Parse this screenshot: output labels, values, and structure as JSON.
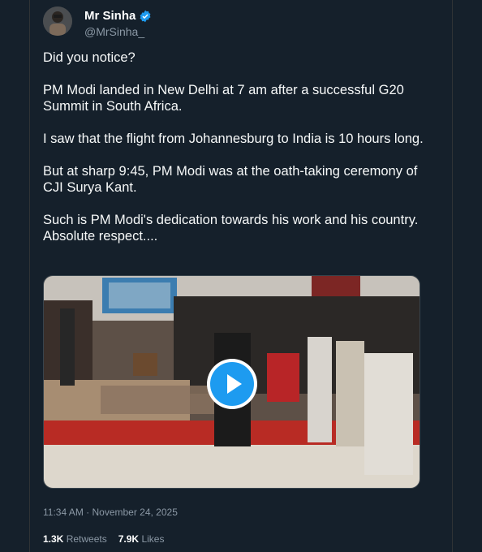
{
  "author": {
    "display_name": "Mr Sinha",
    "handle": "@MrSinha_",
    "verified_icon": "verified-badge-icon",
    "accent_color": "#1d9bf0"
  },
  "tweet": {
    "paragraphs": [
      "Did you notice?",
      "PM Modi landed in New Delhi at 7 am after a successful G20 Summit in South Africa.",
      "I saw that the flight from Johannesburg to India is 10 hours long.",
      "But at sharp 9:45, PM Modi was at the oath-taking ceremony of CJI Surya Kant.",
      "Such is PM Modi's dedication towards his work and his country. Absolute respect...."
    ],
    "media_icon": "play-icon"
  },
  "meta": {
    "timestamp": "11:34 AM · November 24, 2025"
  },
  "stats": {
    "retweets_count": "1.3K",
    "retweets_label": "Retweets",
    "likes_count": "7.9K",
    "likes_label": "Likes"
  }
}
